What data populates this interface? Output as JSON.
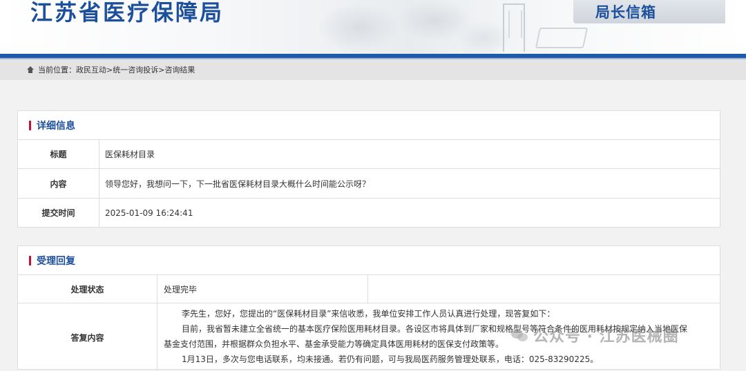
{
  "header": {
    "site_title": "江苏省医疗保障局",
    "mailbox_label": "局长信箱"
  },
  "breadcrumb": {
    "prefix": "当前位置：",
    "items": [
      "政民互动",
      "统一咨询投诉",
      "咨询结果"
    ],
    "separator": "> "
  },
  "detail": {
    "heading": "详细信息",
    "rows": [
      {
        "label": "标题",
        "value": "医保耗材目录"
      },
      {
        "label": "内容",
        "value": "领导您好，我想问一下，下一批省医保耗材目录大概什么时间能公示呀？"
      },
      {
        "label": "提交时间",
        "value": "2025-01-09 16:24:41"
      }
    ]
  },
  "reply": {
    "heading": "受理回复",
    "status_label": "处理状态",
    "status_value": "处理完毕",
    "content_label": "答复内容",
    "paragraphs": [
      "李先生，您好，您提出的“医保耗材目录”来信收悉，我单位安排工作人员认真进行处理，现答复如下：",
      "目前，我省暂未建立全省统一的基本医疗保险医用耗材目录。各设区市将具体到厂家和规格型号等符合条件的医用耗材按规定纳入当地医保",
      "基金支付范围，并根据群众负担水平、基金承受能力等确定具体医用耗材的医保支付政策等。",
      "1月13日，多次与您电话联系，均未接通。若仍有问题，可与我局医药服务管理处联系，电话：025-83290225。"
    ]
  },
  "watermark": {
    "text": "公众号 · 江苏医械圈"
  }
}
